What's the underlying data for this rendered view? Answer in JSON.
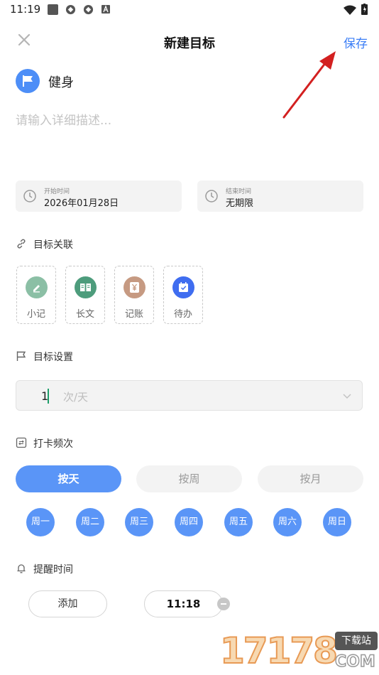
{
  "status_bar": {
    "time": "11:19"
  },
  "header": {
    "title": "新建目标",
    "save_label": "保存"
  },
  "goal": {
    "name": "健身",
    "description_placeholder": "请输入详细描述..."
  },
  "dates": {
    "start": {
      "label": "开始时间",
      "value": "2026年01月28日"
    },
    "end": {
      "label": "结束时间",
      "value": "无期限"
    }
  },
  "link_section": {
    "title": "目标关联",
    "tiles": [
      {
        "label": "小记",
        "color": "#8bbfa5"
      },
      {
        "label": "长文",
        "color": "#4d9c7c"
      },
      {
        "label": "记账",
        "color": "#c69a82"
      },
      {
        "label": "待办",
        "color": "#3f6df0"
      }
    ]
  },
  "target_section": {
    "title": "目标设置",
    "value": "1",
    "unit": "次/天"
  },
  "frequency_section": {
    "title": "打卡频次",
    "options": [
      "按天",
      "按周",
      "按月"
    ],
    "selected": "按天",
    "days": [
      "周一",
      "周二",
      "周三",
      "周四",
      "周五",
      "周六",
      "周日"
    ]
  },
  "reminder_section": {
    "title": "提醒时间",
    "add_label": "添加",
    "time": "11:18"
  },
  "watermark": {
    "number": "17178",
    "tag": "下载站",
    "domain": "COM"
  },
  "colors": {
    "accent": "#5a95f7",
    "link_blue": "#3b7ef6",
    "annotation_arrow": "#d32020"
  }
}
